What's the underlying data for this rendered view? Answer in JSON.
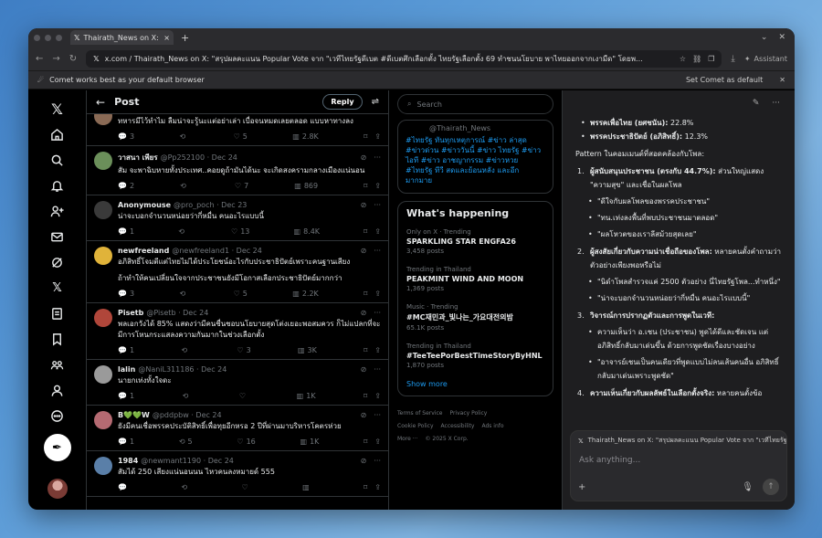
{
  "browser": {
    "tab_title": "Thairath_News on X: \"สรุป",
    "url": "x.com / Thairath_News on X: \"สรุปผลคะแนน Popular Vote จาก \"เวทีไทยรัฐดีเบต #ดีเบตศึกเลือกตั้ง ไทยรัฐเลือกตั้ง 69 ทำชนนโยบาย พาไทยออกจากเงามืด\" โดยพ...",
    "assistant_label": "Assistant",
    "info_text": "Comet works best as your default browser",
    "set_default_label": "Set Comet as default"
  },
  "post_header": {
    "title": "Post",
    "reply_label": "Reply"
  },
  "tweets": [
    {
      "name": "",
      "handle": "",
      "text": "ทหารมีไว้ทำไม ลืมน่าจะรู้นะแต่อย่าเล่า เบื่อจนหมดเลยตลอด แบบหาทางลง",
      "text2": "",
      "replies": "3",
      "reposts": "",
      "likes": "5",
      "views": "2.8K",
      "avatar_color": "#8a6a55"
    },
    {
      "name": "วาสนา เพียร",
      "handle": "@Pp252100 · Dec 24",
      "text": "สัม จะพาฉิบหายทั้งประเทศ..คอยดูถ้ามันได้นะ จะเกิดสงครามกลางเมืองแน่นอน",
      "text2": "",
      "replies": "2",
      "reposts": "",
      "likes": "7",
      "views": "869",
      "avatar_color": "#6b8f5a"
    },
    {
      "name": "Anonymouse",
      "handle": "@pro_poch · Dec 23",
      "text": "น่าจะบอกจำนวนหน่อยว่ากี่หมื่น คนอะไรแบบนี้",
      "text2": "",
      "replies": "1",
      "reposts": "",
      "likes": "13",
      "views": "8.4K",
      "avatar_color": "#3a3a3a"
    },
    {
      "name": "newfreeland",
      "handle": "@newfreeland1 · Dec 24",
      "text": "อภิสิทธิ์โจมตีแต่ไทยไม่ได้ประโยชน์อะไรกับประชาธิปัตย์เพราะคนฐานเสียง",
      "text2": "ถ้าทำให้คนเปลี่ยนใจจากประชาชนยังมีโอกาสเลือกประชาธิปัตย์มากกว่า",
      "replies": "3",
      "reposts": "",
      "likes": "5",
      "views": "2.2K",
      "avatar_color": "#e0b33a"
    },
    {
      "name": "Pisetb",
      "handle": "@Pisetb · Dec 24",
      "text": "พลเอกวังได้ 85% แสดงว่ามีคนชื่นชอบนโยบายสุดโต่งเยอะพอสมควร ก็ไม่แปลกที่จะมีการโหนกระแสลงความกันมากในช่วงเลือกตั้ง",
      "text2": "",
      "replies": "1",
      "reposts": "",
      "likes": "3",
      "views": "3K",
      "avatar_color": "#b0463a"
    },
    {
      "name": "lalin",
      "handle": "@NaniL311186 · Dec 24",
      "text": "นายกเท่งทั้งใจดะ",
      "text2": "",
      "replies": "1",
      "reposts": "",
      "likes": "",
      "views": "1K",
      "avatar_color": "#9a9a9a"
    },
    {
      "name": "B💚💚W",
      "handle": "@pddpbw · Dec 24",
      "text": "ยังมีคนเชื่อพรรคประบัติสิทธิ์เพื่อทุยอีกหรอ 2 ปีที่ผ่านมาบริหารโคตรห่วย",
      "text2": "",
      "replies": "1",
      "reposts": "5",
      "likes": "16",
      "views": "1K",
      "avatar_color": "#b56a72"
    },
    {
      "name": "1984",
      "handle": "@newmant1190 · Dec 24",
      "text": "สัมได้ 250 เสียงแน่นอนนน ไหวคนลงหมายด์ 555",
      "text2": "",
      "replies": "",
      "reposts": "",
      "likes": "",
      "views": "",
      "avatar_color": "#5a7fa8"
    }
  ],
  "right": {
    "search_placeholder": "Search",
    "retweet_handle": "@Thairath_News",
    "retweet_tags": "#ไทยรัฐ ทันทุกเหตุการณ์ #ข่าว ล่าสุด #ข่าวด่วน #ข่าววันนี้ #ข่าว ไทยรัฐ #ข่าวไอที #ข่าว อาชญากรรม #ข่าวหวย #ไทยรัฐ ทีวี สดและย้อนหลัง และอีก มากมาย",
    "happening_title": "What's happening",
    "trends": [
      {
        "meta": "Only on X · Trending",
        "name": "SPARKLING STAR ENGFA26",
        "count": "3,458 posts"
      },
      {
        "meta": "Trending in Thailand",
        "name": "PEAKMINT WIND AND MOON",
        "count": "1,369 posts"
      },
      {
        "meta": "Music · Trending",
        "name": "#MC재민과_빛나는_가요대전의밤",
        "count": "65.1K posts"
      },
      {
        "meta": "Trending in Thailand",
        "name": "#TeeTeePorBestTimeStoryByHNL",
        "count": "1,870 posts"
      }
    ],
    "show_more": "Show more",
    "footer": [
      "Terms of Service",
      "Privacy Policy",
      "Cookie Policy",
      "Accessibility",
      "Ads info",
      "More ···",
      "© 2025 X Corp."
    ]
  },
  "assistant": {
    "lines": [
      {
        "kind": "bullet",
        "bold": "พรรคเพื่อไทย (ยศชนัน):",
        "text": " 22.8%"
      },
      {
        "kind": "bullet",
        "bold": "พรรคประชาธิปัตย์ (อภิสิทธิ์):",
        "text": " 12.3%"
      }
    ],
    "pattern_heading": "Pattern ในคอมเมนต์ที่สอดคล้องกับโพล:",
    "items": [
      {
        "num": "1.",
        "bold": "ผู้สนับสนุนประชาชน (ตรงกับ 44.7%):",
        "text": " ส่วนใหญ่แสดง \"ความสุข\" และเชื่อในผลโพล",
        "subs": [
          "\"ดีใจกับผลโพลของพรรคประชาชน\"",
          "\"ทน.เท่งลงพื้นที่พบประชาชนมาตลอด\"",
          "\"ผลโหวตของเราลีสม้วยสุดเลย\""
        ]
      },
      {
        "num": "2.",
        "bold": "ผู้สงสัยเกี่ยวกับความน่าเชื่อถือของโพล:",
        "text": " หลายคนตั้งคำถามว่าตัวอย่างเพียงพอหรือไม่",
        "subs": [
          "\"นิดำโพลสำรวจแค่ 2500 ตัวอย่าง นี่ไทยรัฐโพล...ทำหนึ่ง\"",
          "\"น่าจะบอกจำนวนหน่อยว่ากี่หมื่น คนอะไรแบบนี้\""
        ]
      },
      {
        "num": "3.",
        "bold": "วิจารณ์การปรากฏตัวและการพูดในเวที:",
        "text": "",
        "subs": [
          "ความเห็นว่า อ.เชน (ประชาชน) พูดได้ดีและชัดเจน แต่อภิสิทธิ์กลับมาเด่นขึ้น ด้วยการพูดชัดเรื่องบางอย่าง",
          "\"อาจารย์เชนเป็นคนเดียวที่พูดแบบไม่ลนเส้นคนอื่น อภิสิทธิ์กลับมาเด่นเพราะพูดชัด\""
        ]
      },
      {
        "num": "4.",
        "bold": "ความเห็นเกี่ยวกับผลลัพธ์ในเลือกตั้งจริง:",
        "text": " หลายคนตั้งข้อ",
        "subs": []
      }
    ],
    "context_text": "Thairath_News on X: \"สรุปผลคะแนน Popular Vote จาก \"เวทีไทยรัฐ",
    "ask_placeholder": "Ask anything..."
  }
}
